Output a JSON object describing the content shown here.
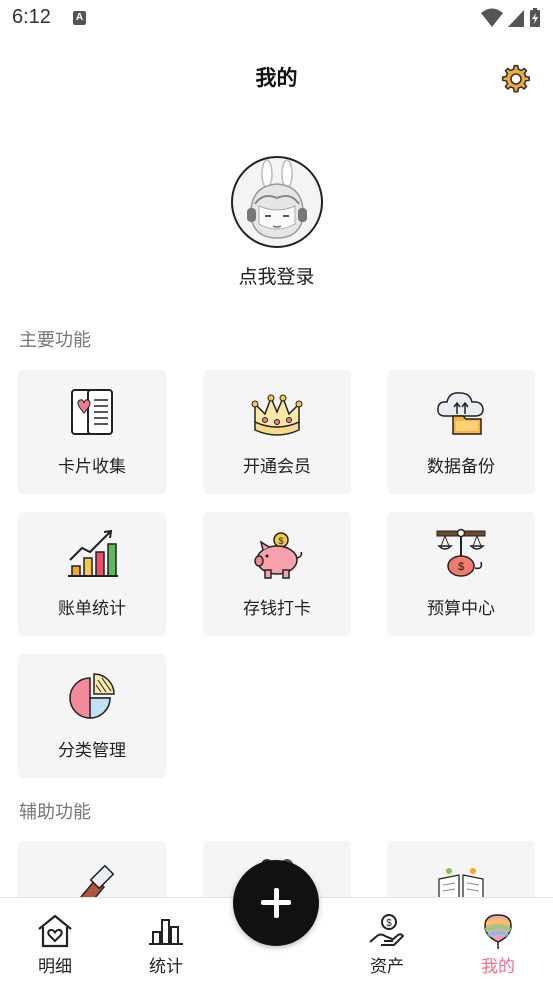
{
  "status_bar": {
    "time": "6:12",
    "notification_icon_letter": "A",
    "icons": [
      "wifi-icon",
      "signal-icon",
      "battery-charging-icon"
    ]
  },
  "header": {
    "title": "我的",
    "settings_icon": "gear-icon"
  },
  "profile": {
    "login_label": "点我登录",
    "avatar_icon": "avatar-girl-headphones"
  },
  "main_functions": {
    "title": "主要功能",
    "items": [
      {
        "label": "卡片收集",
        "icon": "card-collection-icon"
      },
      {
        "label": "开通会员",
        "icon": "crown-icon"
      },
      {
        "label": "数据备份",
        "icon": "cloud-folder-icon"
      },
      {
        "label": "账单统计",
        "icon": "bar-chart-icon"
      },
      {
        "label": "存钱打卡",
        "icon": "piggy-bank-icon"
      },
      {
        "label": "预算中心",
        "icon": "budget-scale-icon"
      },
      {
        "label": "分类管理",
        "icon": "pie-chart-icon"
      }
    ]
  },
  "aux_functions": {
    "title": "辅助功能",
    "items": [
      {
        "label": "",
        "icon": "paint-brush-icon"
      },
      {
        "label": "",
        "icon": "aux-tool-icon"
      },
      {
        "label": "",
        "icon": "notebook-icon"
      }
    ]
  },
  "bottom_nav": {
    "items": [
      {
        "label": "明细",
        "icon": "house-heart-icon",
        "active": false
      },
      {
        "label": "统计",
        "icon": "stats-bars-icon",
        "active": false
      },
      {
        "label": "资产",
        "icon": "hand-coin-icon",
        "active": false
      },
      {
        "label": "我的",
        "icon": "balloon-icon",
        "active": true
      }
    ],
    "fab_icon": "plus-icon"
  },
  "colors": {
    "accent": "#f06f8a",
    "card_bg": "#f5f5f5",
    "fab_bg": "#111111"
  }
}
